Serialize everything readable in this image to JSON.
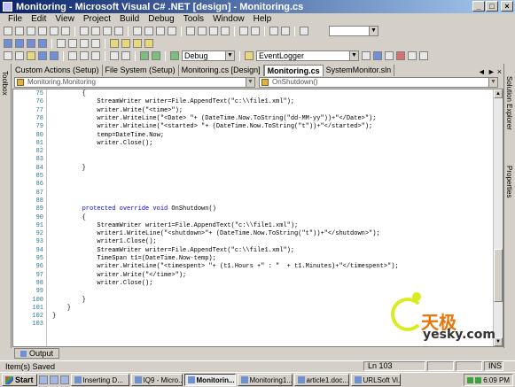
{
  "window": {
    "title": "Monitoring - Microsoft Visual C# .NET [design] - Monitoring.cs"
  },
  "menu": [
    "File",
    "Edit",
    "View",
    "Project",
    "Build",
    "Debug",
    "Tools",
    "Window",
    "Help"
  ],
  "toolbar": {
    "config": "Debug",
    "startup": "EventLogger"
  },
  "side": {
    "left": "Toolbox",
    "right_top": "Solution Explorer",
    "right_bottom": "Properties"
  },
  "tabs": [
    {
      "label": "Custom Actions (Setup)",
      "active": false
    },
    {
      "label": "File System (Setup)",
      "active": false
    },
    {
      "label": "Monitoring.cs [Design]",
      "active": false
    },
    {
      "label": "Monitoring.cs",
      "active": true
    },
    {
      "label": "SystemMonitor.sln",
      "active": false
    }
  ],
  "tab_nav": [
    "◄",
    "►",
    "×"
  ],
  "dropdowns": {
    "class": "Monitoring.Monitoring",
    "member": "OnShutdown()"
  },
  "code_lines": [
    {
      "n": "75",
      "t": "        {"
    },
    {
      "n": "76",
      "t": "            StreamWriter writer=File.AppendText(\"c:\\\\file1.xml\");"
    },
    {
      "n": "77",
      "t": "            writer.Write(\"<time>\");"
    },
    {
      "n": "78",
      "t": "            writer.WriteLine(\"<Date> \"+ (DateTime.Now.ToString(\"dd-MM-yy\"))+\"</Date>\");"
    },
    {
      "n": "79",
      "t": "            writer.WriteLine(\"<started> \"+ (DateTime.Now.ToString(\"t\"))+\"</started>\");"
    },
    {
      "n": "80",
      "t": "            temp=DateTime.Now;"
    },
    {
      "n": "81",
      "t": "            writer.Close();"
    },
    {
      "n": "82",
      "t": ""
    },
    {
      "n": "83",
      "t": ""
    },
    {
      "n": "84",
      "t": "        }"
    },
    {
      "n": "85",
      "t": ""
    },
    {
      "n": "86",
      "t": ""
    },
    {
      "n": "87",
      "t": ""
    },
    {
      "n": "88",
      "t": ""
    },
    {
      "n": "89",
      "t": "        protected override void OnShutdown()"
    },
    {
      "n": "90",
      "t": "        {"
    },
    {
      "n": "91",
      "t": "            StreamWriter writer1=File.AppendText(\"c:\\\\file1.xml\");"
    },
    {
      "n": "92",
      "t": "            writer1.WriteLine(\"<shutdown>\"+ (DateTime.Now.ToString(\"t\"))+\"</shutdown>\");"
    },
    {
      "n": "93",
      "t": "            writer1.Close();"
    },
    {
      "n": "94",
      "t": "            StreamWriter writer=File.AppendText(\"c:\\\\file1.xml\");"
    },
    {
      "n": "95",
      "t": "            TimeSpan t1=(DateTime.Now-temp);"
    },
    {
      "n": "96",
      "t": "            writer.WriteLine(\"<timespent> \"+ (t1.Hours +\" : \"  + t1.Minutes)+\"</timespent>\");"
    },
    {
      "n": "97",
      "t": "            writer.Write(\"</time>\");"
    },
    {
      "n": "98",
      "t": "            writer.Close();"
    },
    {
      "n": "99",
      "t": ""
    },
    {
      "n": "100",
      "t": "        }"
    },
    {
      "n": "101",
      "t": "    }"
    },
    {
      "n": "102",
      "t": "}"
    },
    {
      "n": "103",
      "t": ""
    }
  ],
  "logo": {
    "cn": "天极",
    "url": "yesky.com"
  },
  "output": {
    "label": "Output"
  },
  "status": {
    "text": "Item(s) Saved",
    "ln": "Ln 103",
    "ins": "INS"
  },
  "taskbar": {
    "start": "Start",
    "tasks": [
      {
        "label": "Inserting D...",
        "active": false
      },
      {
        "label": "IQ9 - Micro...",
        "active": false
      },
      {
        "label": "Monitorin...",
        "active": true
      },
      {
        "label": "Monitoring1...",
        "active": false
      },
      {
        "label": "article1.doc...",
        "active": false
      },
      {
        "label": "URLSoft Vi...",
        "active": false
      }
    ],
    "clock": "6:09 PM"
  }
}
